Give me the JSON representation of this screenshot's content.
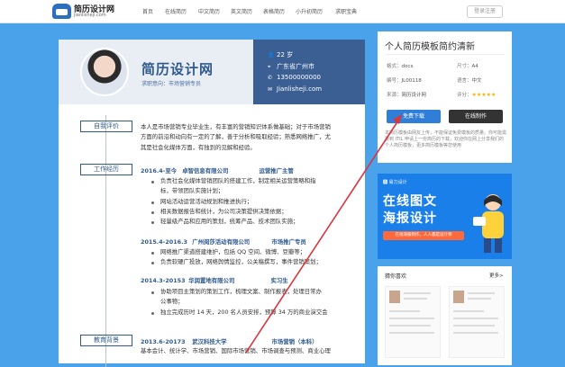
{
  "nav": {
    "logo_title": "简历设计网",
    "logo_url": "jianlisheji.com",
    "links": [
      "首页",
      "在线简历",
      "中文简历",
      "英文简历",
      "表格简历",
      "小升初简历",
      "求职宝典"
    ],
    "login": "登录注册"
  },
  "resume": {
    "name": "简历设计网",
    "intent": "求职意向：市场营销专员",
    "age": "22 岁",
    "location": "广东省广州市",
    "phone": "13500000000",
    "email": "Jianlisheji.com",
    "sections": {
      "self_eval": "自我评价",
      "work": "工作经历",
      "edu": "教育背景"
    },
    "self_eval_lines": [
      "本人是市场营销专业毕业生，有丰富的营销知识体系做基础；对于市场营销",
      "方面的前沿和动向有一定的了解，善于分析和吸取经验；熟悉网络推广，尤",
      "其是社会化媒体方面，有独到的见解和经验。"
    ],
    "jobs": [
      {
        "period": "2016.4-至今",
        "company": "卓智信息有限公司",
        "title": "运营推广主管",
        "bullets": [
          "负责社会化媒体营销团队的搭建工作，制定相关运营策略和指",
          "标，带领团队实施计划；",
          "网站活动运营活动规划和推进执行；",
          "相关数据报告和统计，为公司决策提供决策依据；",
          "轻量级产品和应用的策划，统筹产品、技术团队实施；"
        ]
      },
      {
        "period": "2015.4-2016.3",
        "company": "广州阅莎活动有限公司",
        "title": "市场推广专员",
        "bullets": [
          "网络推广渠道搭建维护，包括 QQ 空间、微博、豆瓣等；",
          "负责软硬广投放，网络舆情监控，公关稿撰写，事件营销策划；"
        ]
      },
      {
        "period": "2014.3-20153",
        "company": "华润置地有限公司",
        "title": "实习生",
        "bullets": [
          "协助项目主策划的策划工作，梳理文案、制作报表，处理日常办",
          "公事物；",
          "独立完成历时 14 天，200 名人员安排，预算 34 万的商业演交会"
        ]
      }
    ],
    "edu": {
      "period": "2013.6-20173",
      "school": "武汉科技大学",
      "major": "市场营销（本科）",
      "line": "基本会计、统计学、市场营销、国际市场营销、市场调查与预测、商业心理"
    }
  },
  "sidebar": {
    "title": "个人简历模板简约清新",
    "format_label": "格式：",
    "format": "docx",
    "size_label": "尺寸：",
    "size": "A4",
    "id_label": "编号：",
    "id": "JL00118",
    "lang_label": "语言：",
    "lang": "中文",
    "source_label": "来源：",
    "source": "简历设计网",
    "rating_label": "评分：",
    "rating": "★★★★★",
    "rating_value": 5,
    "download": "免费下载",
    "online": "在线制作",
    "desc": "本简历模板由网友上传，不能保证免费模板的质量。你可能需要到 ITIL 申请上一份简历的下载，欢迎你在网上分享我们的个人简历模板，更多简历模板等您使用"
  },
  "banner": {
    "brand": "🅱 易力设计",
    "line1": "在线图文",
    "line2": "海报设计",
    "sub": "在线海报制作，人人都是设计师"
  },
  "likes": {
    "title": "猜你喜欢",
    "more": "更多>"
  },
  "colors": {
    "background": "#4aa3ea",
    "accent": "#2f5a8f",
    "info_panel": "#3b5f93",
    "download": "#2f7fd8",
    "arrow": "#d9363e"
  }
}
